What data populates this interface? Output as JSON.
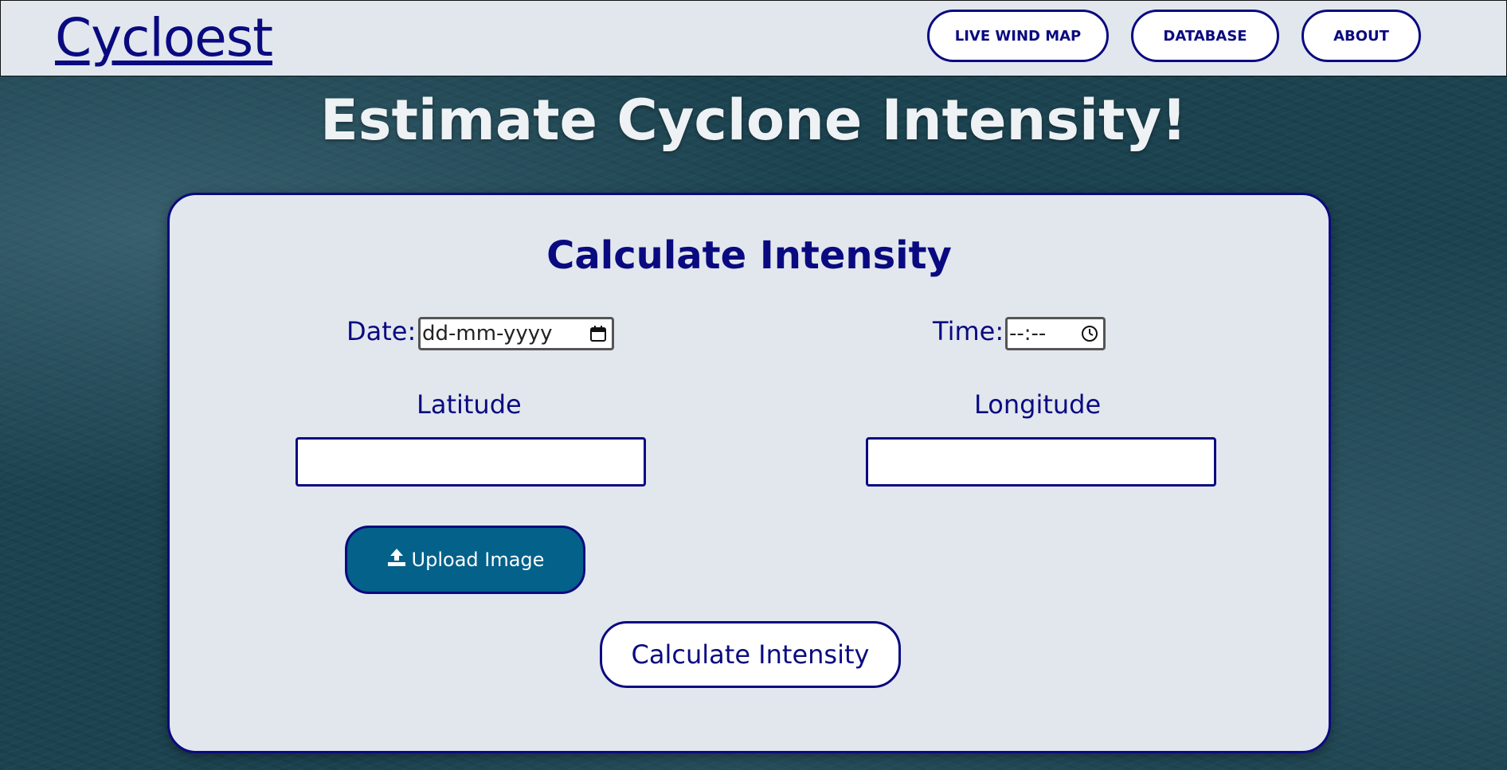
{
  "navbar": {
    "brand": "Cycloest",
    "links": {
      "live_wind_map": "LIVE WIND MAP",
      "database": "DATABASE",
      "about": "ABOUT"
    }
  },
  "hero": {
    "title": "Estimate Cyclone Intensity!"
  },
  "form": {
    "title": "Calculate Intensity",
    "date_label": "Date:",
    "date_placeholder": "dd-mm-yyyy",
    "time_label": "Time:",
    "time_placeholder": "--:--",
    "latitude_label": "Latitude",
    "latitude_value": "",
    "longitude_label": "Longitude",
    "longitude_value": "",
    "upload_label": "Upload Image",
    "submit_label": "Calculate Intensity"
  },
  "colors": {
    "primary": "#0a0a80",
    "panel": "#e2e7ee",
    "upload_button": "#03618a",
    "ocean_background": "#1c4350"
  },
  "icons": {
    "date": "calendar-icon",
    "time": "clock-icon",
    "upload": "upload-icon"
  }
}
